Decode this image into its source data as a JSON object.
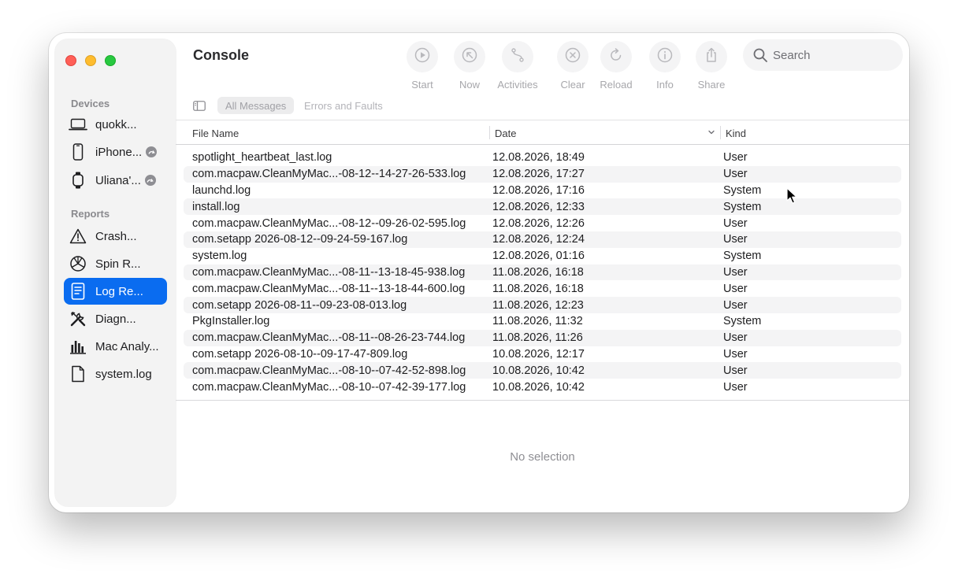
{
  "window": {
    "title": "Console"
  },
  "sidebar": {
    "sections": {
      "devices": "Devices",
      "reports": "Reports"
    },
    "devices": [
      {
        "label": "quokk...",
        "icon": "laptop-icon"
      },
      {
        "label": "iPhone...",
        "icon": "iphone-icon",
        "badge": "paired-badge-icon"
      },
      {
        "label": "Uliana'...",
        "icon": "watch-icon",
        "badge": "paired-badge-icon"
      }
    ],
    "reports": [
      {
        "label": "Crash...",
        "icon": "warning-triangle-icon"
      },
      {
        "label": "Spin R...",
        "icon": "spin-wheel-icon"
      },
      {
        "label": "Log Re...",
        "icon": "document-lines-icon",
        "selected": true
      },
      {
        "label": "Diagn...",
        "icon": "tools-icon"
      },
      {
        "label": "Mac Analy...",
        "icon": "bar-chart-icon"
      },
      {
        "label": "system.log",
        "icon": "document-icon"
      }
    ]
  },
  "toolbar": {
    "start": "Start",
    "now": "Now",
    "activities": "Activities",
    "clear": "Clear",
    "reload": "Reload",
    "info": "Info",
    "share": "Share"
  },
  "search": {
    "placeholder": "Search"
  },
  "filters": {
    "all_messages": "All Messages",
    "errors_and_faults": "Errors and Faults"
  },
  "table": {
    "columns": {
      "file_name": "File Name",
      "date": "Date",
      "kind": "Kind"
    },
    "sort": {
      "column": "Date",
      "direction": "descending"
    },
    "rows": [
      {
        "name": "spotlight_heartbeat_last.log",
        "date": "12.08.2026, 18:49",
        "kind": "User"
      },
      {
        "name": "com.macpaw.CleanMyMac...-08-12--14-27-26-533.log",
        "date": "12.08.2026, 17:27",
        "kind": "User"
      },
      {
        "name": "launchd.log",
        "date": "12.08.2026, 17:16",
        "kind": "System"
      },
      {
        "name": "install.log",
        "date": "12.08.2026, 12:33",
        "kind": "System"
      },
      {
        "name": "com.macpaw.CleanMyMac...-08-12--09-26-02-595.log",
        "date": "12.08.2026, 12:26",
        "kind": "User"
      },
      {
        "name": "com.setapp 2026-08-12--09-24-59-167.log",
        "date": "12.08.2026, 12:24",
        "kind": "User"
      },
      {
        "name": "system.log",
        "date": "12.08.2026, 01:16",
        "kind": "System"
      },
      {
        "name": "com.macpaw.CleanMyMac...-08-11--13-18-45-938.log",
        "date": "11.08.2026, 16:18",
        "kind": "User"
      },
      {
        "name": "com.macpaw.CleanMyMac...-08-11--13-18-44-600.log",
        "date": "11.08.2026, 16:18",
        "kind": "User"
      },
      {
        "name": "com.setapp 2026-08-11--09-23-08-013.log",
        "date": "11.08.2026, 12:23",
        "kind": "User"
      },
      {
        "name": "PkgInstaller.log",
        "date": "11.08.2026, 11:32",
        "kind": "System"
      },
      {
        "name": "com.macpaw.CleanMyMac...-08-11--08-26-23-744.log",
        "date": "11.08.2026, 11:26",
        "kind": "User"
      },
      {
        "name": "com.setapp 2026-08-10--09-17-47-809.log",
        "date": "10.08.2026, 12:17",
        "kind": "User"
      },
      {
        "name": "com.macpaw.CleanMyMac...-08-10--07-42-52-898.log",
        "date": "10.08.2026, 10:42",
        "kind": "User"
      },
      {
        "name": "com.macpaw.CleanMyMac...-08-10--07-42-39-177.log",
        "date": "10.08.2026, 10:42",
        "kind": "User"
      }
    ]
  },
  "detail": {
    "empty_text": "No selection"
  },
  "colors": {
    "accent": "#0a6cf0",
    "close": "#ff5f57",
    "minimize": "#febc2e",
    "zoom": "#28c840"
  }
}
